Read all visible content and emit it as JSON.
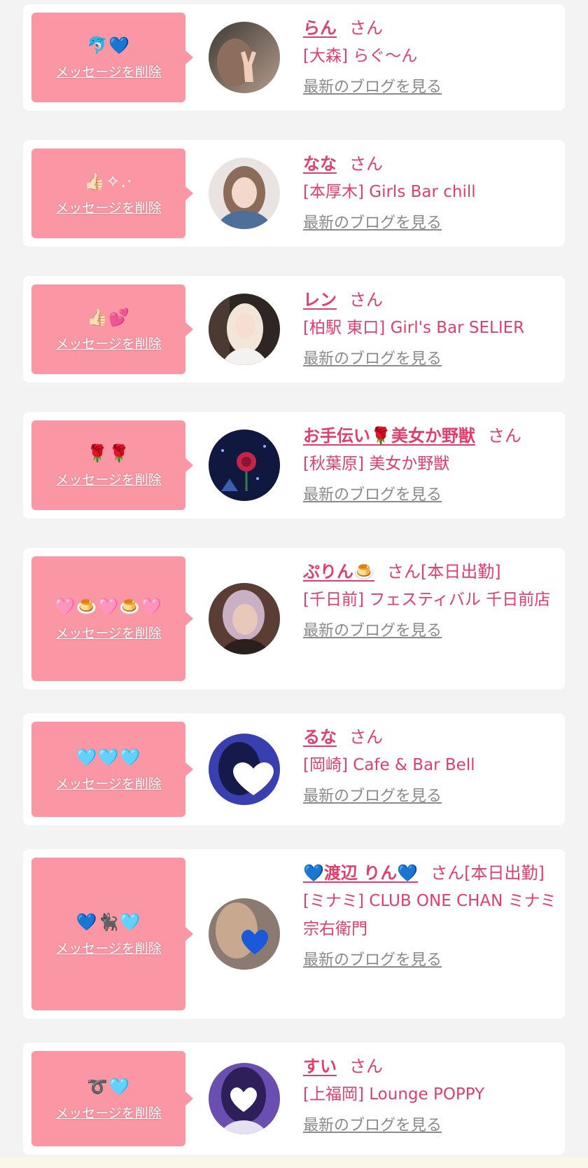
{
  "delete_label": "メッセージを削除",
  "blog_label": "最新のブログを見る",
  "san_label": "さん",
  "colors": {
    "accent": "#e23e6c",
    "bubble": "#fb96a4",
    "link_gray": "#8a8a8a",
    "page_bg": "#f3f3f3"
  },
  "messages": [
    {
      "emoji": "🐬💙",
      "name": "らん",
      "suffix": "さん",
      "shop": "[大森] らぐ〜ん",
      "avatar_icon": "peace-sign-photo"
    },
    {
      "emoji": "👍🏻✧.·",
      "name": "なな",
      "suffix": "さん",
      "shop": "[本厚木] Girls Bar chill",
      "avatar_icon": "girl-photo"
    },
    {
      "emoji": "👍🏻💕",
      "name": "レン",
      "suffix": "さん",
      "shop": "[柏駅 東口] Girl's Bar SELIER",
      "avatar_icon": "girl-photo"
    },
    {
      "emoji": "🌹🌹",
      "name": "お手伝い🌹美女か野獣",
      "suffix": "さん",
      "shop": "[秋葉原] 美女か野獣",
      "avatar_icon": "rose-photo"
    },
    {
      "emoji": "🩷🍮🩷🍮🩷",
      "name": "ぷりん🍮",
      "suffix": "さん[本日出勤]",
      "shop": "[千日前] フェスティバル 千日前店",
      "avatar_icon": "girl-photo"
    },
    {
      "emoji": "🩵🩵🩵",
      "name": "るな",
      "suffix": "さん",
      "shop": "[岡崎] Cafe & Bar Bell",
      "avatar_icon": "heart-face-photo"
    },
    {
      "emoji": "💙🐈‍⬛🩵",
      "name": "💙渡辺 りん💙",
      "suffix": "さん[本日出勤]",
      "shop": "[ミナミ] CLUB ONE CHAN ミナミ 宗右衛門",
      "avatar_icon": "heart-face-photo"
    },
    {
      "emoji": "➰🩵",
      "name": "すい",
      "suffix": "さん",
      "shop": "[上福岡] Lounge POPPY",
      "avatar_icon": "heart-face-photo"
    }
  ]
}
